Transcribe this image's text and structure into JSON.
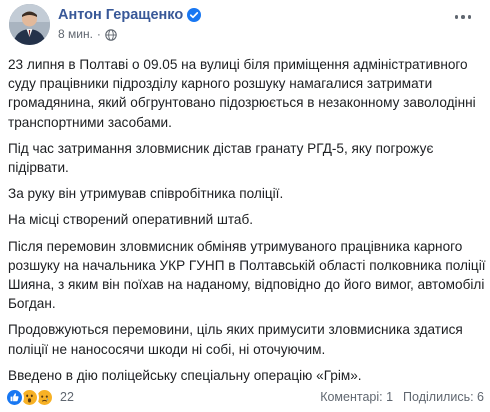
{
  "author": {
    "name": "Антон Геращенко",
    "verified_icon": "verified-badge-icon",
    "avatar_icon": "profile-avatar"
  },
  "meta": {
    "time": "8 мин.",
    "separator": "·",
    "audience_icon": "globe-icon"
  },
  "more_icon": "more-options-icon",
  "post": {
    "paragraphs": [
      "23 липня в Полтаві о 09.05 на вулиці біля приміщення адміністративного суду працівники підрозділу карного розшуку намагалися затримати громадянина, який обгрунтовано підозрюється в незаконному заволодінні транспортними засобами.",
      "Під час затримання зловмисник дістав гранату РГД-5, яку погрожує підірвати.",
      "За руку він утримував співробітника поліції.",
      "На місці створений оперативний штаб.",
      "Після перемовин зловмисник обміняв утримуваного працівника карного розшуку на начальника УКР ГУНП в Полтавській області полковника поліції Шияна, з яким він поїхав на наданому, відповідно до його вимог, автомобілі Богдан.",
      "Продовжуються перемовини, ціль яких примусити зловмисника здатися поліції не нанососячи шкоди ні собі, ні оточуючим.",
      "Введено в дію поліцейську спеціальну операцію «Грім»."
    ]
  },
  "reactions": {
    "icons": [
      "like-icon",
      "wow-icon",
      "sad-icon"
    ],
    "count": "22"
  },
  "stats": {
    "comments": "Коментарі: 1",
    "shares": "Поділились: 6"
  },
  "colors": {
    "link": "#385898",
    "like": "#1877f2",
    "emoji": "#f7b125"
  }
}
